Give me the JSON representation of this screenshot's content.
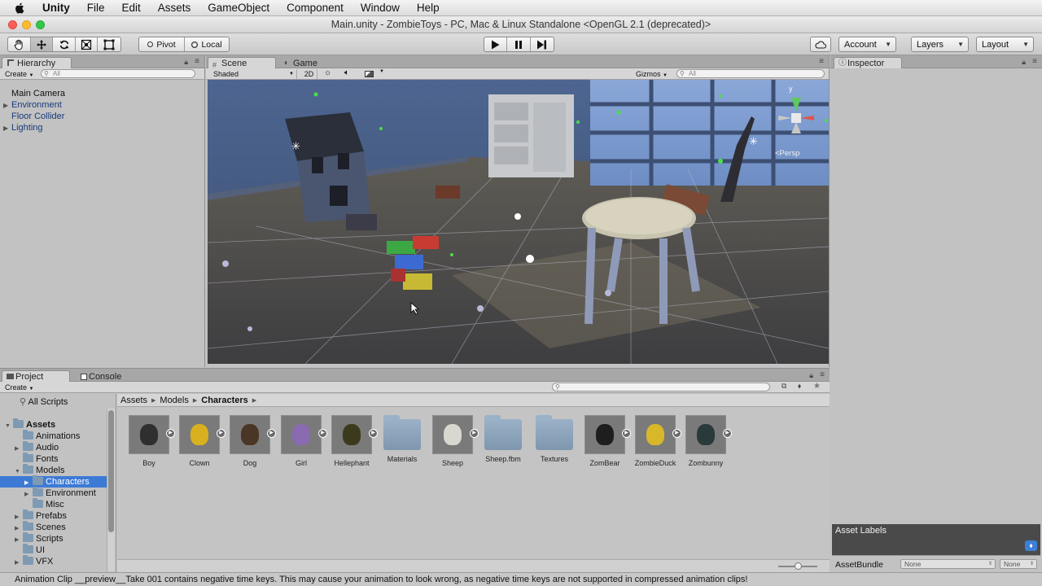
{
  "menubar": {
    "items": [
      "Unity",
      "File",
      "Edit",
      "Assets",
      "GameObject",
      "Component",
      "Window",
      "Help"
    ]
  },
  "window": {
    "title": "Main.unity - ZombieToys - PC, Mac & Linux Standalone <OpenGL 2.1 (deprecated)>"
  },
  "toolbar": {
    "pivot_label": "Pivot",
    "local_label": "Local",
    "account_label": "Account",
    "layers_label": "Layers",
    "layout_label": "Layout"
  },
  "hierarchy": {
    "tab_label": "Hierarchy",
    "create_label": "Create",
    "search_placeholder": "All",
    "items": [
      {
        "label": "Main Camera",
        "foldout": false,
        "color": "#111111"
      },
      {
        "label": "Environment",
        "foldout": true,
        "color": "#173a7a"
      },
      {
        "label": "Floor Collider",
        "foldout": false,
        "color": "#173a7a"
      },
      {
        "label": "Lighting",
        "foldout": true,
        "color": "#173a7a"
      }
    ]
  },
  "scene": {
    "scene_tab_label": "Scene",
    "game_tab_label": "Game",
    "shading_mode": "Shaded",
    "mode_2d_label": "2D",
    "gizmos_label": "Gizmos",
    "search_placeholder": "All",
    "axis_y": "y",
    "persp_label": "<Persp"
  },
  "inspector": {
    "tab_label": "Inspector",
    "asset_labels_title": "Asset Labels",
    "asset_bundle_label": "AssetBundle",
    "bundle_value": "None",
    "variant_value": "None"
  },
  "project": {
    "project_tab_label": "Project",
    "console_tab_label": "Console",
    "create_label": "Create",
    "breadcrumb": [
      "Assets",
      "Models",
      "Characters"
    ],
    "tree": [
      {
        "label": "All Scripts",
        "depth": 0,
        "kind": "search",
        "selected": false,
        "foldout": "none"
      },
      {
        "label": "Assets",
        "depth": 0,
        "kind": "folder",
        "selected": false,
        "foldout": "open",
        "bold": true
      },
      {
        "label": "Animations",
        "depth": 1,
        "kind": "folder",
        "selected": false,
        "foldout": "none"
      },
      {
        "label": "Audio",
        "depth": 1,
        "kind": "folder",
        "selected": false,
        "foldout": "closed"
      },
      {
        "label": "Fonts",
        "depth": 1,
        "kind": "folder",
        "selected": false,
        "foldout": "none"
      },
      {
        "label": "Models",
        "depth": 1,
        "kind": "folder",
        "selected": false,
        "foldout": "open"
      },
      {
        "label": "Characters",
        "depth": 2,
        "kind": "folder",
        "selected": true,
        "foldout": "closed"
      },
      {
        "label": "Environment",
        "depth": 2,
        "kind": "folder",
        "selected": false,
        "foldout": "closed"
      },
      {
        "label": "Misc",
        "depth": 2,
        "kind": "folder",
        "selected": false,
        "foldout": "none"
      },
      {
        "label": "Prefabs",
        "depth": 1,
        "kind": "folder",
        "selected": false,
        "foldout": "closed"
      },
      {
        "label": "Scenes",
        "depth": 1,
        "kind": "folder",
        "selected": false,
        "foldout": "closed"
      },
      {
        "label": "Scripts",
        "depth": 1,
        "kind": "folder",
        "selected": false,
        "foldout": "closed"
      },
      {
        "label": "UI",
        "depth": 1,
        "kind": "folder",
        "selected": false,
        "foldout": "none"
      },
      {
        "label": "VFX",
        "depth": 1,
        "kind": "folder",
        "selected": false,
        "foldout": "closed"
      }
    ],
    "assets": [
      {
        "label": "Boy",
        "kind": "model",
        "color": "#2f2f2f"
      },
      {
        "label": "Clown",
        "kind": "model",
        "color": "#d8b020"
      },
      {
        "label": "Dog",
        "kind": "model",
        "color": "#4a3624"
      },
      {
        "label": "Girl",
        "kind": "model",
        "color": "#8a6ab0"
      },
      {
        "label": "Hellephant",
        "kind": "model",
        "color": "#3c3a1c"
      },
      {
        "label": "Materials",
        "kind": "folder",
        "color": "#8aa3bb"
      },
      {
        "label": "Sheep",
        "kind": "model",
        "color": "#d8d8d0"
      },
      {
        "label": "Sheep.fbm",
        "kind": "folder",
        "color": "#8aa3bb"
      },
      {
        "label": "Textures",
        "kind": "folder",
        "color": "#8aa3bb"
      },
      {
        "label": "ZomBear",
        "kind": "model",
        "color": "#1e1e1e"
      },
      {
        "label": "ZombieDuck",
        "kind": "model",
        "color": "#d8b828"
      },
      {
        "label": "Zombunny",
        "kind": "model",
        "color": "#2a3a3a"
      }
    ]
  },
  "status": {
    "message": "Animation Clip __preview__Take 001 contains negative time keys. This may cause your animation to look wrong, as negative time keys are not supported in compressed animation clips!"
  }
}
